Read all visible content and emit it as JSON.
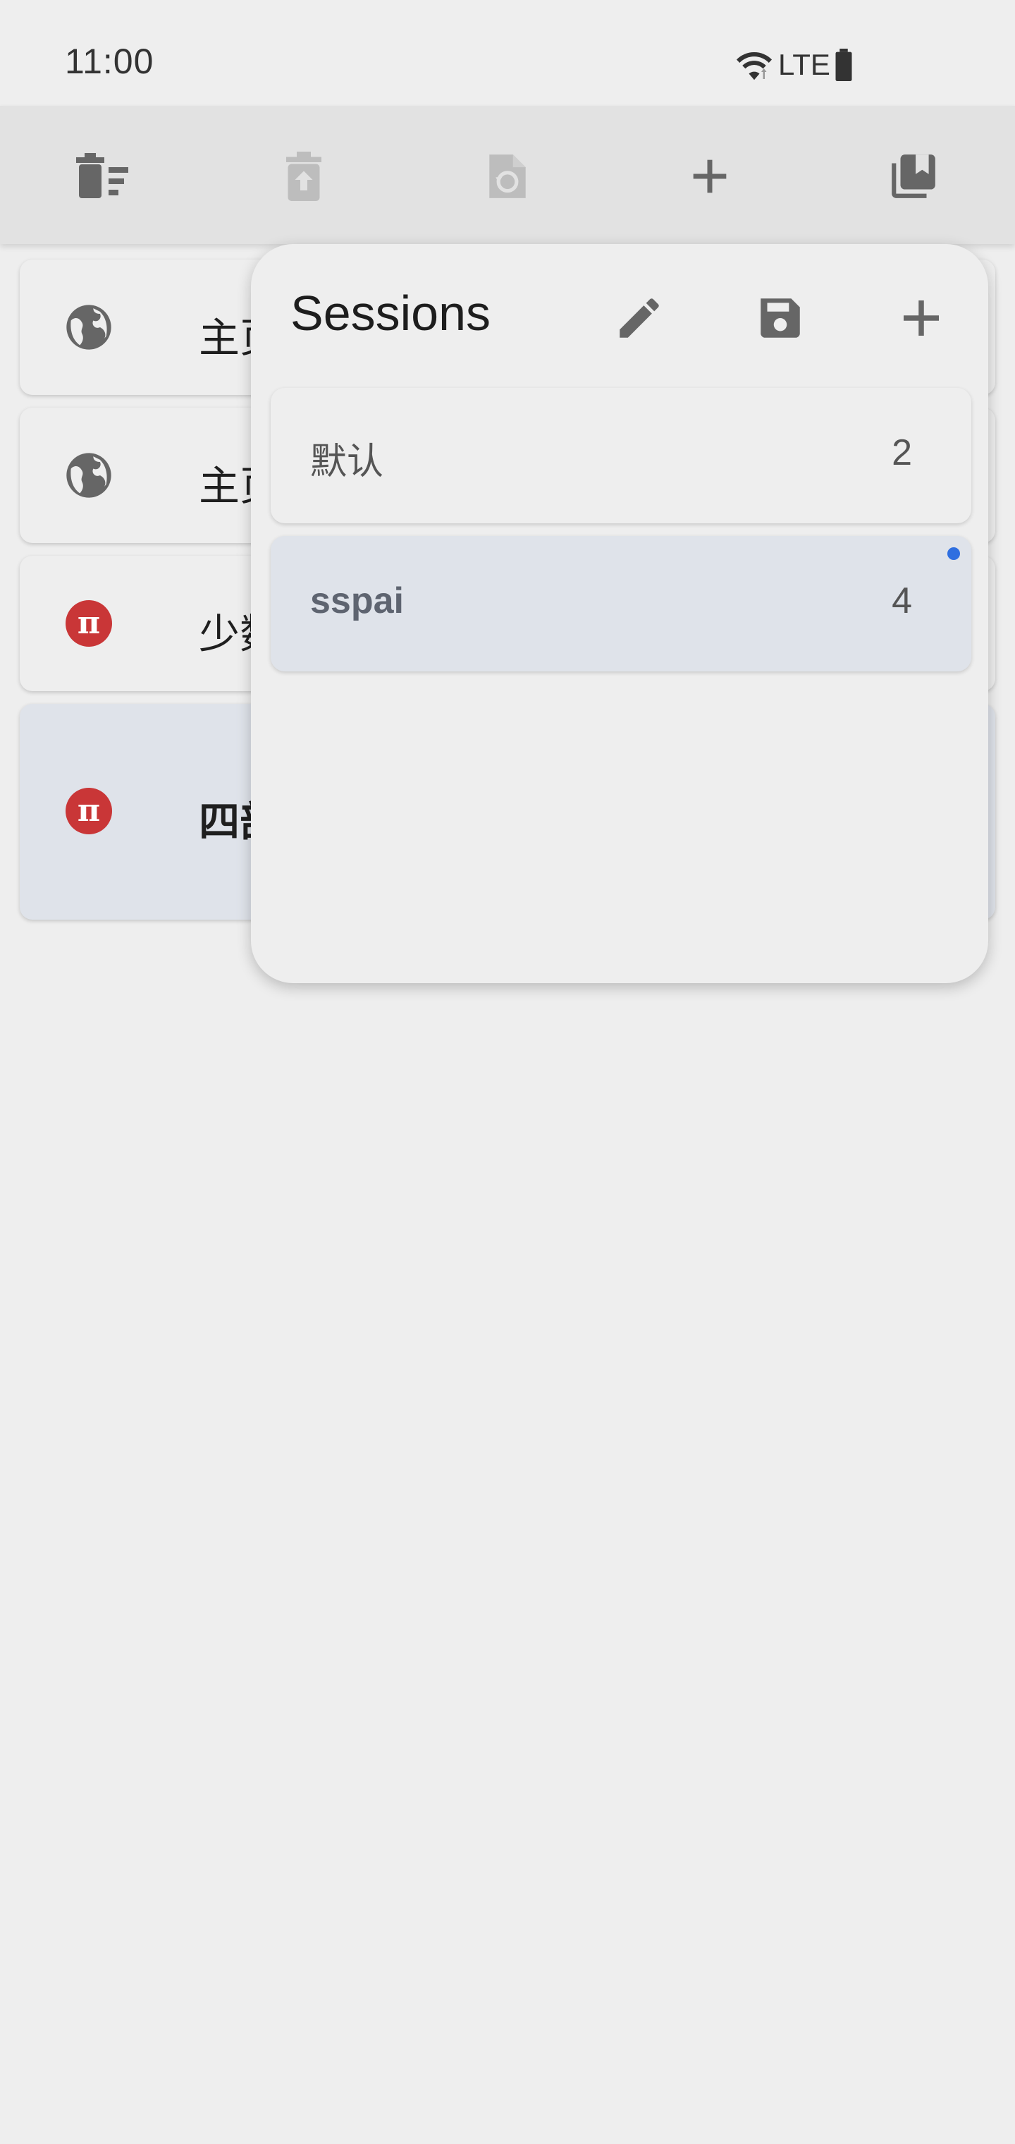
{
  "status_bar": {
    "time": "11:00",
    "network": "LTE",
    "icons": [
      "wifi-icon",
      "battery-icon"
    ]
  },
  "toolbar": {
    "buttons": [
      {
        "name": "close-all-tabs-button",
        "icon": "trash-list-icon",
        "enabled": true
      },
      {
        "name": "restore-closed-tab-button",
        "icon": "trash-restore-icon",
        "enabled": false
      },
      {
        "name": "restore-session-button",
        "icon": "file-restore-icon",
        "enabled": false
      },
      {
        "name": "new-tab-button",
        "icon": "plus-icon",
        "enabled": true
      },
      {
        "name": "sessions-button",
        "icon": "bookmarks-icon",
        "enabled": true
      }
    ]
  },
  "tabs": [
    {
      "title": "主页",
      "icon": "globe-icon",
      "active": false
    },
    {
      "title": "主页",
      "icon": "globe-icon",
      "active": false
    },
    {
      "title": "少数派",
      "icon": "sspai-pi-icon",
      "active": false
    },
    {
      "title": "四部",
      "icon": "sspai-pi-icon",
      "active": true
    }
  ],
  "sessions_panel": {
    "title": "Sessions",
    "actions": [
      "edit-icon",
      "save-icon",
      "plus-icon"
    ],
    "items": [
      {
        "name": "默认",
        "count": "2",
        "selected": false
      },
      {
        "name": "sspai",
        "count": "4",
        "selected": true
      }
    ]
  },
  "colors": {
    "background": "#eeeeee",
    "toolbar": "#e2e2e2",
    "active_tab": "#dfe3ea",
    "sspai_red": "#c93637",
    "dot_blue": "#2f6fe0",
    "icon_gray": "#666666",
    "icon_disabled": "#bdbdbd"
  }
}
